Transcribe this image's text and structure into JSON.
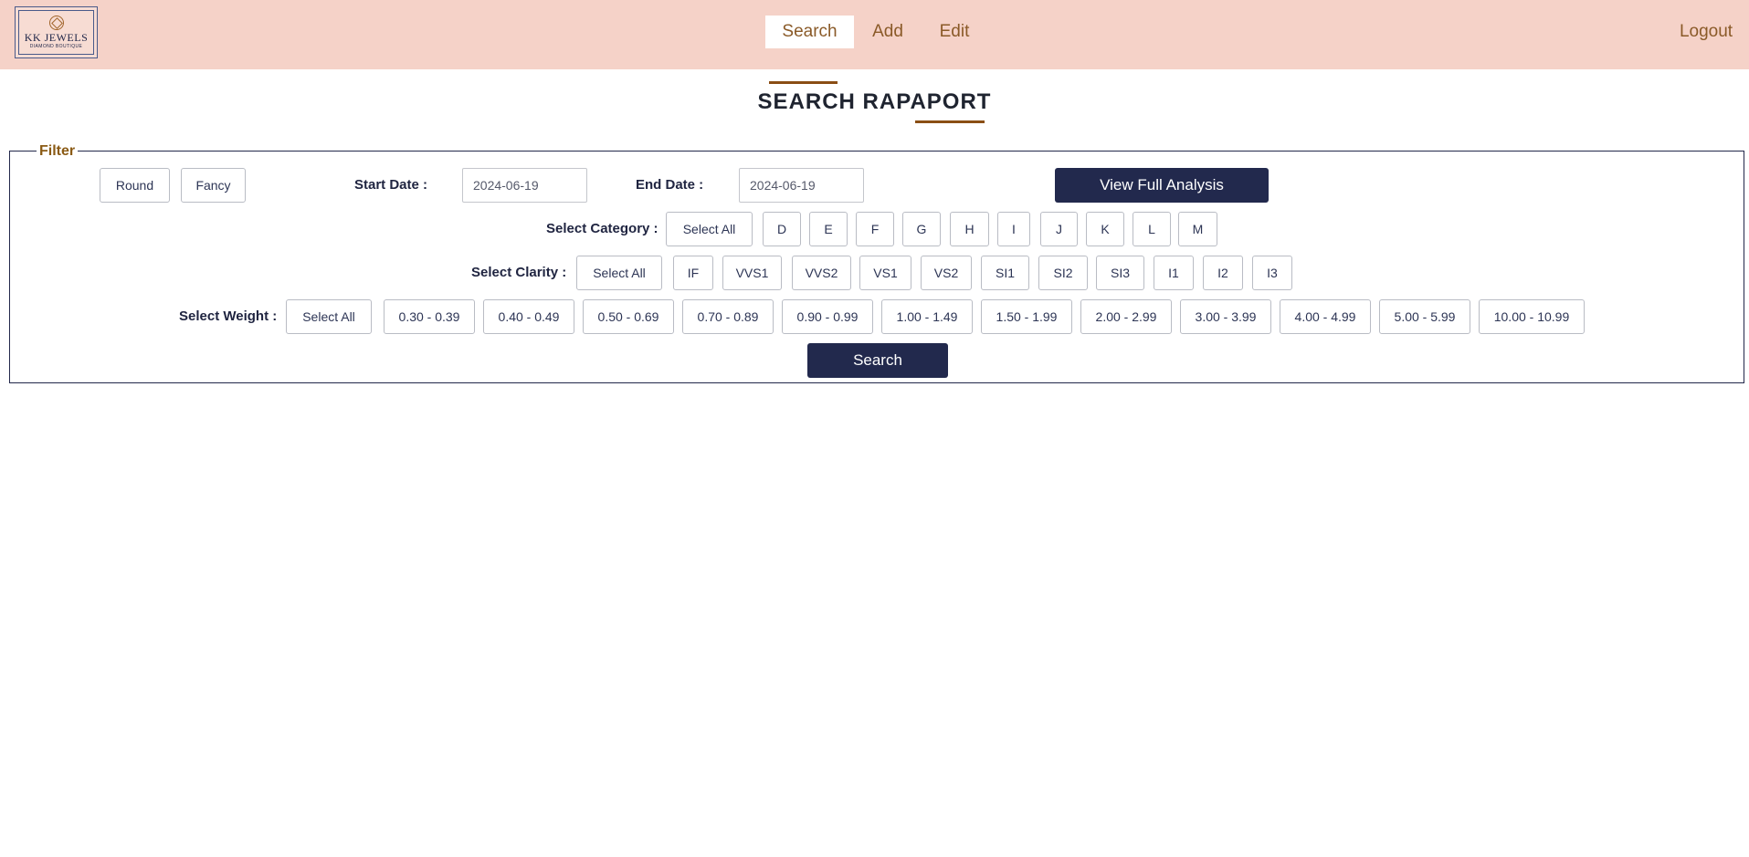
{
  "header": {
    "logo": {
      "name": "KK JEWELS",
      "tagline": "DIAMOND BOUTIQUE"
    },
    "nav": [
      {
        "label": "Search"
      },
      {
        "label": "Add"
      },
      {
        "label": "Edit"
      }
    ],
    "logout_label": "Logout",
    "active_tab": "Search"
  },
  "page": {
    "title": "SEARCH RAPAPORT"
  },
  "filter": {
    "legend": "Filter",
    "shapes": [
      "Round",
      "Fancy"
    ],
    "start_date_label": "Start Date :",
    "start_date_value": "2024-06-19",
    "end_date_label": "End Date :",
    "end_date_value": "2024-06-19",
    "view_full_analysis_label": "View Full Analysis",
    "category_label": "Select Category :",
    "category_select_all": "Select All",
    "categories": [
      "D",
      "E",
      "F",
      "G",
      "H",
      "I",
      "J",
      "K",
      "L",
      "M"
    ],
    "clarity_label": "Select Clarity :",
    "clarity_select_all": "Select All",
    "clarities": [
      "IF",
      "VVS1",
      "VVS2",
      "VS1",
      "VS2",
      "SI1",
      "SI2",
      "SI3",
      "I1",
      "I2",
      "I3"
    ],
    "weight_label": "Select Weight :",
    "weight_select_all": "Select All",
    "weights": [
      "0.30 - 0.39",
      "0.40 - 0.49",
      "0.50 - 0.69",
      "0.70 - 0.89",
      "0.90 - 0.99",
      "1.00 - 1.49",
      "1.50 - 1.99",
      "2.00 - 2.99",
      "3.00 - 3.99",
      "4.00 - 4.99",
      "5.00 - 5.99",
      "10.00 - 10.99"
    ],
    "search_label": "Search"
  },
  "colors": {
    "header_bg": "#f5d2c8",
    "accent_brown": "#8a4e14",
    "primary_navy": "#22294d"
  }
}
